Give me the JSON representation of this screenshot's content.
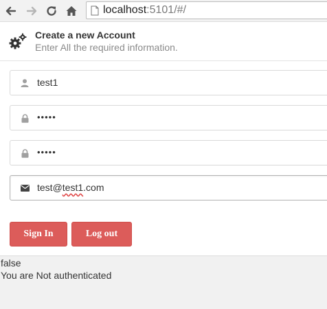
{
  "browser": {
    "url_host": "localhost",
    "url_rest": ":5101/#/"
  },
  "header": {
    "title": "Create a new Account",
    "subtitle": "Enter All the required information."
  },
  "form": {
    "username": "test1",
    "password": "•••••",
    "confirm_password": "•••••",
    "email_prefix": "test@",
    "email_misspelled": "test1",
    "email_suffix": ".com"
  },
  "buttons": {
    "sign_in": "Sign In",
    "log_out": "Log out"
  },
  "status": {
    "authenticated_value": "false",
    "message": "You are Not authenticated"
  },
  "colors": {
    "button_bg": "#dc5c5a",
    "status_bg": "#f1f1f1"
  },
  "icons": [
    "back-icon",
    "forward-icon",
    "reload-icon",
    "home-icon",
    "page-icon",
    "gears-icon",
    "user-icon",
    "lock-icon",
    "envelope-icon"
  ]
}
